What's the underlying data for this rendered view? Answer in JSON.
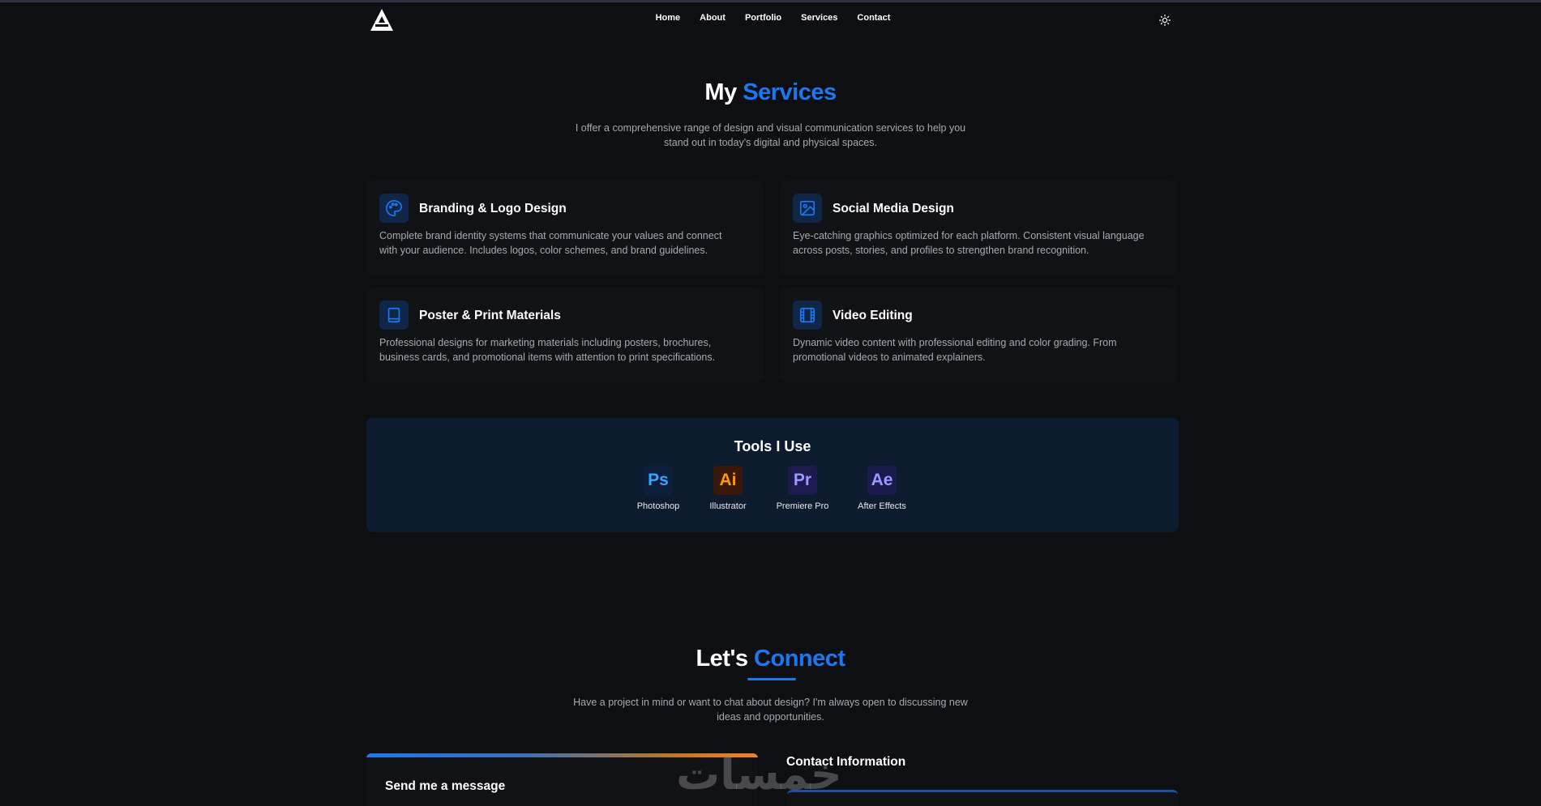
{
  "nav": {
    "links": [
      "Home",
      "About",
      "Portfolio",
      "Services",
      "Contact"
    ]
  },
  "services": {
    "title_prefix": "My",
    "title_accent": "Services",
    "subtitle_line1": "I offer a comprehensive range of design and visual communication services to help you",
    "subtitle_line2": "stand out in today's digital and physical spaces.",
    "cards": [
      {
        "icon": "palette-icon",
        "title": "Branding & Logo Design",
        "desc_line1": "Complete brand identity systems that communicate your values and connect",
        "desc_line2": "with your audience. Includes logos, color schemes, and brand guidelines."
      },
      {
        "icon": "image-icon",
        "title": "Social Media Design",
        "desc_line1": "Eye-catching graphics optimized for each platform. Consistent visual language",
        "desc_line2": "across posts, stories, and profiles to strengthen brand recognition."
      },
      {
        "icon": "book-icon",
        "title": "Poster & Print Materials",
        "desc_line1": "Professional designs for marketing materials including posters, brochures,",
        "desc_line2": "business cards, and promotional items with attention to print specifications."
      },
      {
        "icon": "film-icon",
        "title": "Video Editing",
        "desc_line1": "Dynamic video content with professional editing and color grading. From",
        "desc_line2": "promotional videos to animated explainers."
      }
    ]
  },
  "tools": {
    "title": "Tools I Use",
    "items": [
      {
        "abbr": "Ps",
        "label": "Photoshop",
        "bg": "#0e1f3b",
        "fg": "#31a8ff"
      },
      {
        "abbr": "Ai",
        "label": "Illustrator",
        "bg": "#3a1809",
        "fg": "#ff9a00"
      },
      {
        "abbr": "Pr",
        "label": "Premiere Pro",
        "bg": "#1d1a4d",
        "fg": "#9999ff"
      },
      {
        "abbr": "Ae",
        "label": "After Effects",
        "bg": "#1a1a4d",
        "fg": "#9999ff"
      }
    ]
  },
  "connect": {
    "title_prefix": "Let's",
    "title_accent": "Connect",
    "subtitle_line1": "Have a project in mind or want to chat about design? I'm always open to discussing new",
    "subtitle_line2": "ideas and opportunities.",
    "message_title": "Send me a message",
    "info_title": "Contact Information"
  },
  "watermark": "خمسات",
  "colors": {
    "background": "#0e0f12",
    "accent": "#1d77f2",
    "card": "#111216",
    "tools_panel": "#0c1b2e"
  }
}
